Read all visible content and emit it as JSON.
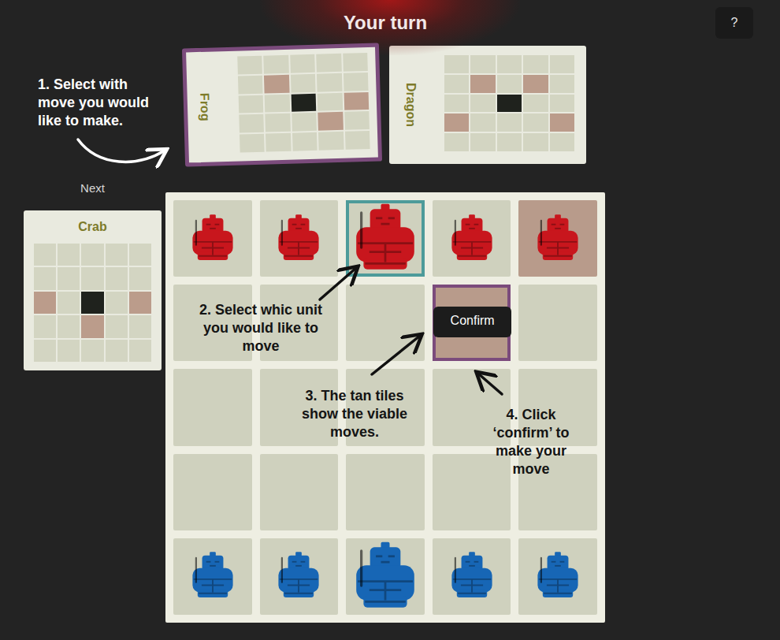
{
  "header": {
    "title": "Your turn"
  },
  "help_button": {
    "label": "?"
  },
  "cards": [
    {
      "name": "Frog",
      "selected": true,
      "grid": [
        [
          "empty",
          "empty",
          "empty",
          "empty",
          "empty"
        ],
        [
          "empty",
          "move",
          "empty",
          "empty",
          "empty"
        ],
        [
          "empty",
          "empty",
          "origin",
          "empty",
          "move"
        ],
        [
          "empty",
          "empty",
          "empty",
          "move",
          "empty"
        ],
        [
          "empty",
          "empty",
          "empty",
          "empty",
          "empty"
        ]
      ]
    },
    {
      "name": "Dragon",
      "selected": false,
      "grid": [
        [
          "empty",
          "empty",
          "empty",
          "empty",
          "empty"
        ],
        [
          "empty",
          "move",
          "empty",
          "move",
          "empty"
        ],
        [
          "empty",
          "empty",
          "origin",
          "empty",
          "empty"
        ],
        [
          "move",
          "empty",
          "empty",
          "empty",
          "move"
        ],
        [
          "empty",
          "empty",
          "empty",
          "empty",
          "empty"
        ]
      ]
    }
  ],
  "next": {
    "label": "Next",
    "card": {
      "name": "Crab",
      "grid": [
        [
          "empty",
          "empty",
          "empty",
          "empty",
          "empty"
        ],
        [
          "empty",
          "empty",
          "empty",
          "empty",
          "empty"
        ],
        [
          "move",
          "empty",
          "origin",
          "empty",
          "move"
        ],
        [
          "empty",
          "empty",
          "move",
          "empty",
          "empty"
        ],
        [
          "empty",
          "empty",
          "empty",
          "empty",
          "empty"
        ]
      ]
    }
  },
  "board": {
    "rows": [
      [
        {
          "piece": {
            "kind": "pawn",
            "color": "#c8161d"
          },
          "tan": false,
          "selected": false,
          "chosen": false
        },
        {
          "piece": {
            "kind": "pawn",
            "color": "#c8161d"
          },
          "tan": false,
          "selected": false,
          "chosen": false
        },
        {
          "piece": {
            "kind": "master",
            "color": "#c8161d"
          },
          "tan": false,
          "selected": true,
          "chosen": false
        },
        {
          "piece": {
            "kind": "pawn",
            "color": "#c8161d"
          },
          "tan": false,
          "selected": false,
          "chosen": false
        },
        {
          "piece": {
            "kind": "pawn",
            "color": "#c8161d"
          },
          "tan": true,
          "selected": false,
          "chosen": false
        }
      ],
      [
        {
          "piece": null,
          "tan": false,
          "selected": false,
          "chosen": false
        },
        {
          "piece": null,
          "tan": false,
          "selected": false,
          "chosen": false
        },
        {
          "piece": null,
          "tan": false,
          "selected": false,
          "chosen": false
        },
        {
          "piece": null,
          "tan": true,
          "selected": false,
          "chosen": true
        },
        {
          "piece": null,
          "tan": false,
          "selected": false,
          "chosen": false
        }
      ],
      [
        {
          "piece": null,
          "tan": false,
          "selected": false,
          "chosen": false
        },
        {
          "piece": null,
          "tan": false,
          "selected": false,
          "chosen": false
        },
        {
          "piece": null,
          "tan": false,
          "selected": false,
          "chosen": false
        },
        {
          "piece": null,
          "tan": false,
          "selected": false,
          "chosen": false
        },
        {
          "piece": null,
          "tan": false,
          "selected": false,
          "chosen": false
        }
      ],
      [
        {
          "piece": null,
          "tan": false,
          "selected": false,
          "chosen": false
        },
        {
          "piece": null,
          "tan": false,
          "selected": false,
          "chosen": false
        },
        {
          "piece": null,
          "tan": false,
          "selected": false,
          "chosen": false
        },
        {
          "piece": null,
          "tan": false,
          "selected": false,
          "chosen": false
        },
        {
          "piece": null,
          "tan": false,
          "selected": false,
          "chosen": false
        }
      ],
      [
        {
          "piece": {
            "kind": "pawn",
            "color": "#1766b5"
          },
          "tan": false,
          "selected": false,
          "chosen": false
        },
        {
          "piece": {
            "kind": "pawn",
            "color": "#1766b5"
          },
          "tan": false,
          "selected": false,
          "chosen": false
        },
        {
          "piece": {
            "kind": "master",
            "color": "#1766b5"
          },
          "tan": false,
          "selected": false,
          "chosen": false
        },
        {
          "piece": {
            "kind": "pawn",
            "color": "#1766b5"
          },
          "tan": false,
          "selected": false,
          "chosen": false
        },
        {
          "piece": {
            "kind": "pawn",
            "color": "#1766b5"
          },
          "tan": false,
          "selected": false,
          "chosen": false
        }
      ]
    ]
  },
  "confirm_button": {
    "label": "Confirm"
  },
  "annotations": [
    {
      "text": "1. Select with move you would like to make."
    },
    {
      "text": "2. Select whic unit you would like to move"
    },
    {
      "text": "3. The tan tiles show the viable moves."
    },
    {
      "text": "4. Click ‘confirm’ to make your move"
    }
  ]
}
